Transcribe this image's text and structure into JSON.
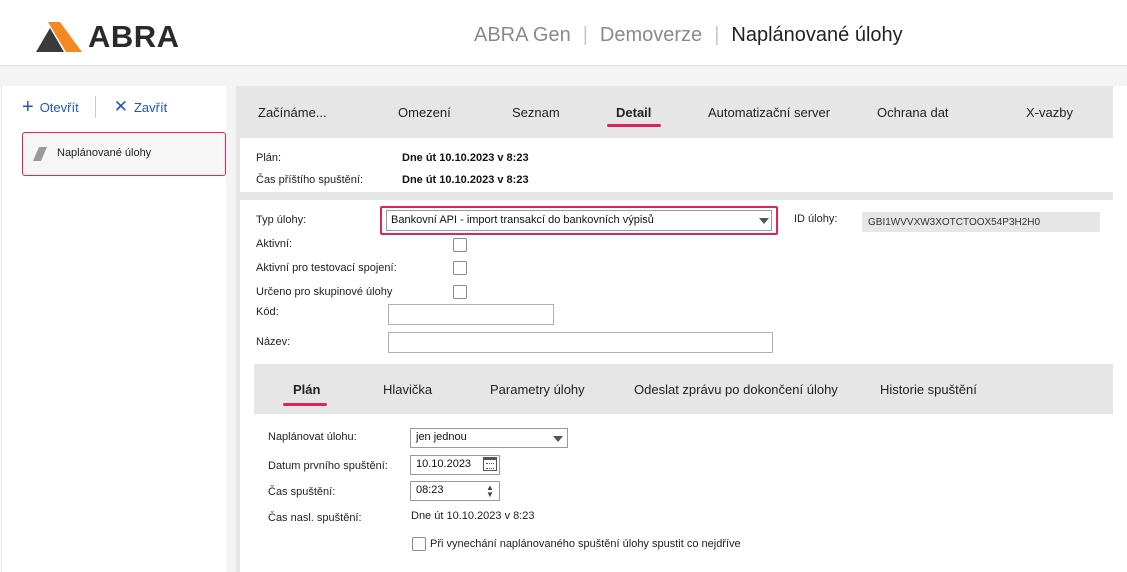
{
  "header": {
    "logo_text": "ABRA",
    "crumbs": [
      "ABRA Gen",
      "Demoverze"
    ],
    "current": "Naplánované úlohy",
    "separator": "|"
  },
  "left": {
    "open_label": "Otevřít",
    "close_label": "Zavřít",
    "open_icon": "plus-icon",
    "close_icon": "x-icon",
    "nav_item_label": "Naplánované úlohy"
  },
  "tabs": [
    {
      "label": "Začínáme...",
      "active": false
    },
    {
      "label": "Omezení",
      "active": false
    },
    {
      "label": "Seznam",
      "active": false
    },
    {
      "label": "Detail",
      "active": true
    },
    {
      "label": "Automatizační server",
      "active": false
    },
    {
      "label": "Ochrana dat",
      "active": false
    },
    {
      "label": "X-vazby",
      "active": false
    }
  ],
  "plan_info": {
    "plan_label": "Plán:",
    "plan_value": "Dne út 10.10.2023 v 8:23",
    "next_label": "Čas příštího spuštění:",
    "next_value": "Dne út 10.10.2023 v 8:23"
  },
  "form": {
    "task_type_label": "Typ úlohy:",
    "task_type_value": "Bankovní API - import transakcí do bankovních výpisů",
    "task_id_label": "ID úlohy:",
    "task_id_value": "GBI1WVVXW3XOTCTOOX54P3H2H0",
    "active_label": "Aktivní:",
    "active_test_label": "Aktivní pro testovací spojení:",
    "group_label": "Určeno pro skupinové úlohy",
    "code_label": "Kód:",
    "code_value": "",
    "name_label": "Název:",
    "name_value": ""
  },
  "subtabs": [
    {
      "label": "Plán",
      "active": true
    },
    {
      "label": "Hlavička",
      "active": false
    },
    {
      "label": "Parametry úlohy",
      "active": false
    },
    {
      "label": "Odeslat zprávu po dokončení úlohy",
      "active": false
    },
    {
      "label": "Historie spuštění",
      "active": false
    }
  ],
  "schedule": {
    "schedule_label": "Naplánovat úlohu:",
    "schedule_value": "jen jednou",
    "first_date_label": "Datum prvního spuštění:",
    "first_date_value": "10.10.2023",
    "time_label": "Čas spuštění:",
    "time_value": "08:23",
    "next_label": "Čas nasl. spuštění:",
    "next_value": "Dne út 10.10.2023 v 8:23",
    "missed_label": "Při vynechání naplánovaného spuštění úlohy spustit co nejdříve"
  },
  "colors": {
    "accent": "#e0235c",
    "link": "#1f56c9",
    "panel": "#e6e6e6",
    "logo_orange": "#f5891f",
    "logo_dark": "#3a3a3a"
  }
}
